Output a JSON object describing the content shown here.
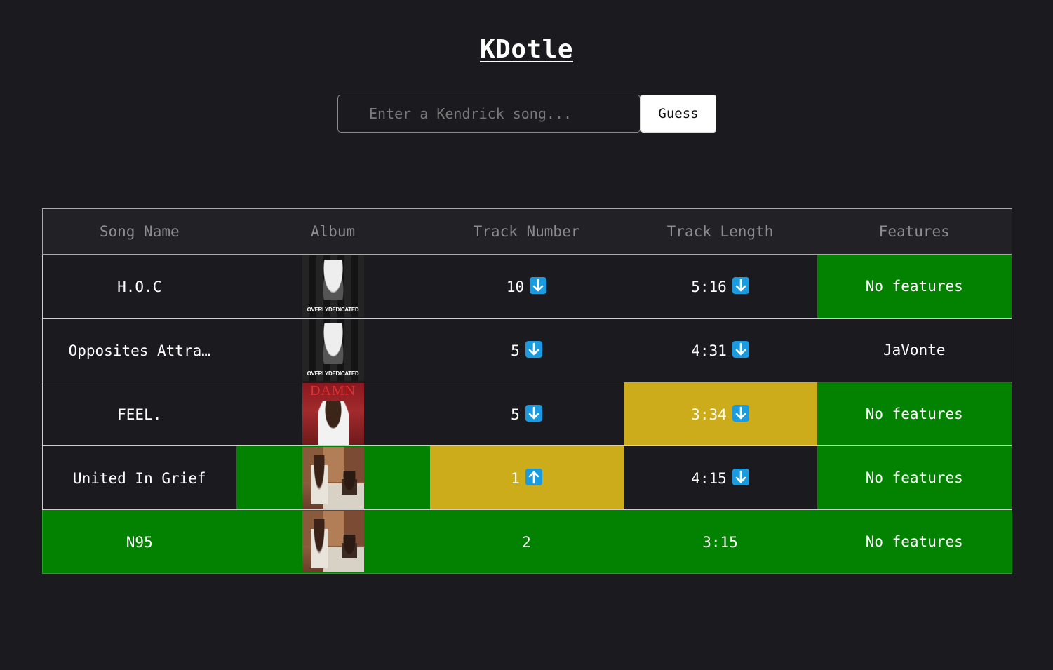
{
  "app": {
    "title": "KDotle"
  },
  "search": {
    "placeholder": "Enter a Kendrick song...",
    "value": "",
    "button_label": "Guess"
  },
  "table": {
    "headers": {
      "song": "Song Name",
      "album": "Album",
      "track_number": "Track Number",
      "track_length": "Track Length",
      "features": "Features"
    },
    "rows": [
      {
        "song": "H.O.C",
        "album_cover": "overly-dedicated-cover",
        "track_number": "10",
        "track_number_hint": "down",
        "track_length": "5:16",
        "track_length_hint": "down",
        "features": "No features"
      },
      {
        "song": "Opposites Attra…",
        "album_cover": "overly-dedicated-cover",
        "track_number": "5",
        "track_number_hint": "down",
        "track_length": "4:31",
        "track_length_hint": "down",
        "features": "JaVonte"
      },
      {
        "song": "FEEL.",
        "album_cover": "damn-cover",
        "album_cover_text": "DAMN",
        "track_number": "5",
        "track_number_hint": "down",
        "track_length": "3:34",
        "track_length_hint": "down",
        "features": "No features"
      },
      {
        "song": "United In Grief",
        "album_cover": "mr-morale-cover",
        "track_number": "1",
        "track_number_hint": "up",
        "track_length": "4:15",
        "track_length_hint": "down",
        "features": "No features"
      },
      {
        "song": "N95",
        "album_cover": "mr-morale-cover",
        "track_number": "2",
        "track_length": "3:15",
        "features": "No features"
      }
    ]
  },
  "colors": {
    "background": "#1b1a1f",
    "correct": "#028200",
    "close": "#ccac1a",
    "hint_arrow": "#1a9be0"
  }
}
